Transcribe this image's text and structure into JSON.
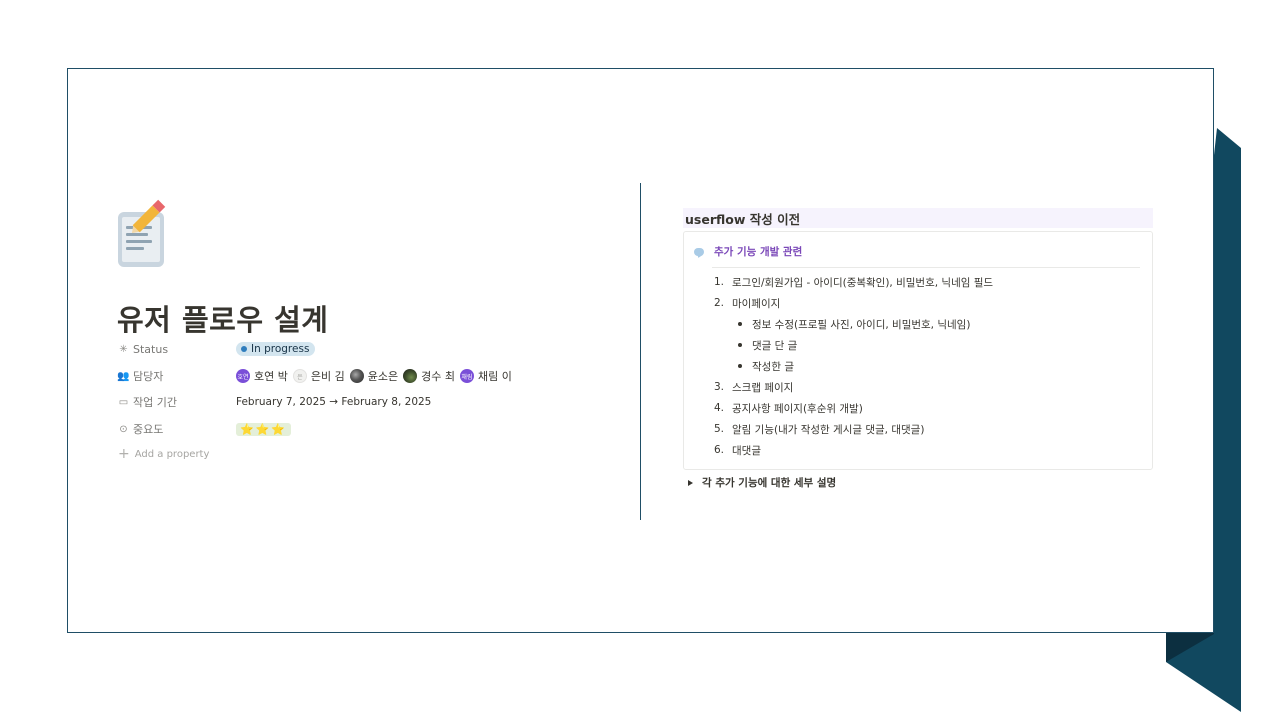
{
  "left": {
    "title": "유저 플로우 설계",
    "properties": {
      "status": {
        "label": "Status",
        "value": "In progress",
        "color": "#d3e5ef"
      },
      "assignees": {
        "label": "담당자",
        "people": [
          {
            "initials": "호연",
            "name": "호연 박"
          },
          {
            "initials": "은",
            "name": "은비 김"
          },
          {
            "initials": "",
            "name": "윤소은"
          },
          {
            "initials": "",
            "name": "경수 최"
          },
          {
            "initials": "채림",
            "name": "채림 이"
          }
        ]
      },
      "period": {
        "label": "작업 기간",
        "value": "February 7, 2025 → February 8, 2025"
      },
      "importance": {
        "label": "중요도",
        "value": "⭐⭐⭐",
        "stars": 3
      },
      "add_property": "Add a property"
    }
  },
  "right": {
    "heading": "userflow 작성 이전",
    "callout": {
      "title": "추가 기능 개발 관련",
      "items": [
        {
          "num": "1.",
          "text": "로그인/회원가입 - 아이디(중복확인), 비밀번호, 닉네임 필드"
        },
        {
          "num": "2.",
          "text": "마이페이지"
        },
        {
          "bullet": true,
          "text": "정보 수정(프로필 사진, 아이디, 비밀번호, 닉네임)"
        },
        {
          "bullet": true,
          "text": "댓글 단 글"
        },
        {
          "bullet": true,
          "text": "작성한 글"
        },
        {
          "num": "3.",
          "text": "스크랩 페이지"
        },
        {
          "num": "4.",
          "text": "공지사항 페이지(후순위 개발)"
        },
        {
          "num": "5.",
          "text": "알림 기능(내가 작성한 게시글 댓글, 대댓글)"
        },
        {
          "num": "6.",
          "text": "대댓글"
        }
      ]
    },
    "toggle": "각 추가 기능에 대한 세부 설명"
  },
  "colors": {
    "accent": "#1f4e66",
    "callout_title": "#7a47b8",
    "heading_bg": "#f6f3fd"
  }
}
